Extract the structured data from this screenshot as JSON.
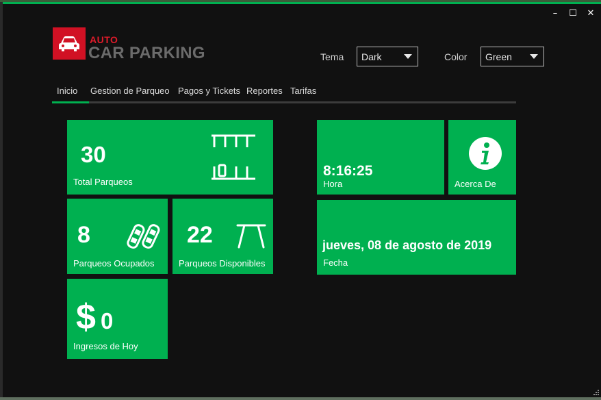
{
  "window": {
    "controls": {
      "minimize": "–",
      "maximize": "☐",
      "close": "✕"
    }
  },
  "logo": {
    "auto": "AUTO",
    "name": "CAR PARKING",
    "icon": "car-icon"
  },
  "header": {
    "theme_label": "Tema",
    "theme_value": "Dark",
    "color_label": "Color",
    "color_value": "Green"
  },
  "tabs": [
    {
      "label": "Inicio",
      "active": true
    },
    {
      "label": "Gestion de Parqueo"
    },
    {
      "label": "Pagos y Tickets"
    },
    {
      "label": "Reportes"
    },
    {
      "label": "Tarifas"
    }
  ],
  "tiles": {
    "total": {
      "value": "30",
      "label": "Total Parqueos",
      "icon": "parking-slots-icon"
    },
    "occupied": {
      "value": "8",
      "label": "Parqueos Ocupados",
      "icon": "parked-cars-icon"
    },
    "available": {
      "value": "22",
      "label": "Parqueos Disponibles",
      "icon": "empty-slot-icon"
    },
    "income": {
      "currency": "$",
      "value": "0",
      "label": "Ingresos de Hoy"
    },
    "time": {
      "value": "8:16:25",
      "label": "Hora"
    },
    "about": {
      "label": "Acerca De",
      "icon": "info-icon"
    },
    "date": {
      "value": "jueves, 08 de agosto de 2019",
      "label": "Fecha"
    }
  },
  "colors": {
    "accent": "#00b050",
    "logo_red": "#d11124",
    "background": "#111111"
  }
}
